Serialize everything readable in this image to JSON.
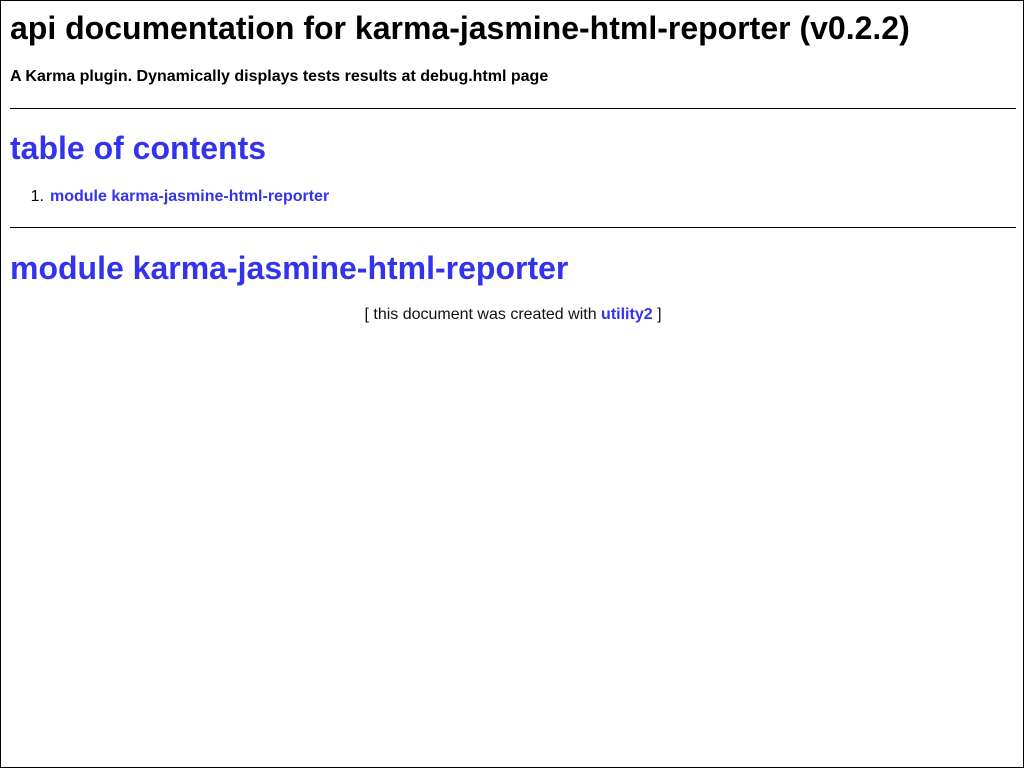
{
  "header": {
    "title": "api documentation for karma-jasmine-html-reporter (v0.2.2)",
    "description": "A Karma plugin. Dynamically displays tests results at debug.html page"
  },
  "toc": {
    "heading": "table of contents",
    "items": [
      {
        "number": "1.",
        "label": "module karma-jasmine-html-reporter"
      }
    ]
  },
  "module": {
    "heading": "module karma-jasmine-html-reporter"
  },
  "footer": {
    "prefix": "[ this document was created with",
    "link_label": "utility2",
    "suffix": "]"
  },
  "colors": {
    "link": "#3333ee",
    "text": "#000000",
    "background": "#ffffff"
  }
}
